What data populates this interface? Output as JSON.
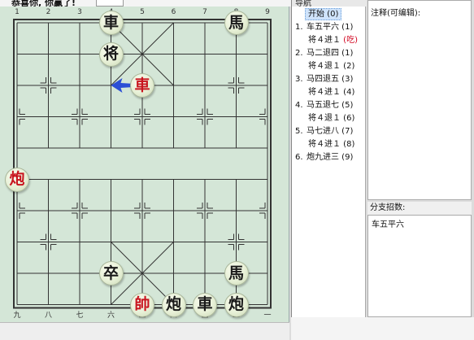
{
  "status_text": "恭喜你, 你赢了!",
  "board": {
    "top_labels": [
      "1",
      "2",
      "3",
      "4",
      "5",
      "6",
      "7",
      "8",
      "9"
    ],
    "bottom_labels": [
      "九",
      "八",
      "七",
      "六",
      "五",
      "四",
      "三",
      "二",
      "一"
    ],
    "pieces": [
      {
        "char": "車",
        "side": "black",
        "file": 3,
        "rank": 0
      },
      {
        "char": "馬",
        "side": "black",
        "file": 7,
        "rank": 0
      },
      {
        "char": "将",
        "side": "black",
        "file": 3,
        "rank": 1
      },
      {
        "char": "車",
        "side": "red",
        "file": 4,
        "rank": 2
      },
      {
        "char": "炮",
        "side": "red",
        "file": 0,
        "rank": 5
      },
      {
        "char": "卒",
        "side": "black",
        "file": 3,
        "rank": 8
      },
      {
        "char": "馬",
        "side": "black",
        "file": 7,
        "rank": 8
      },
      {
        "char": "帥",
        "side": "red",
        "file": 4,
        "rank": 9
      },
      {
        "char": "炮",
        "side": "black",
        "file": 5,
        "rank": 9
      },
      {
        "char": "車",
        "side": "black",
        "file": 6,
        "rank": 9
      },
      {
        "char": "炮",
        "side": "black",
        "file": 7,
        "rank": 9
      }
    ],
    "last_move_arrow": {
      "from_file": 3,
      "from_rank": 2,
      "to_file": 4,
      "to_rank": 2,
      "color": "#2c4fd6"
    },
    "colors": {
      "board_bg": "#d4e6d7",
      "line": "#333333",
      "red": "#c8141e",
      "black": "#1a1a1a"
    }
  },
  "nav": {
    "title": "导航",
    "moves": [
      {
        "num": "",
        "text": "开始 (0)",
        "selected": true
      },
      {
        "num": "1.",
        "text": "车五平六 (1)"
      },
      {
        "num": "",
        "text": "将４进１",
        "capture": "(吃)"
      },
      {
        "num": "2.",
        "text": "马二退四 (1)"
      },
      {
        "num": "",
        "text": "将４退１ (2)"
      },
      {
        "num": "3.",
        "text": "马四退五 (3)"
      },
      {
        "num": "",
        "text": "将４进１ (4)"
      },
      {
        "num": "4.",
        "text": "马五退七 (5)"
      },
      {
        "num": "",
        "text": "将４退１ (6)"
      },
      {
        "num": "5.",
        "text": "马七进八 (7)"
      },
      {
        "num": "",
        "text": "将４进１ (8)"
      },
      {
        "num": "6.",
        "text": "炮九进三 (9)"
      }
    ]
  },
  "notes": {
    "label": "注释(可编辑):"
  },
  "branch": {
    "label": "分支招数:",
    "items": [
      "车五平六"
    ]
  }
}
